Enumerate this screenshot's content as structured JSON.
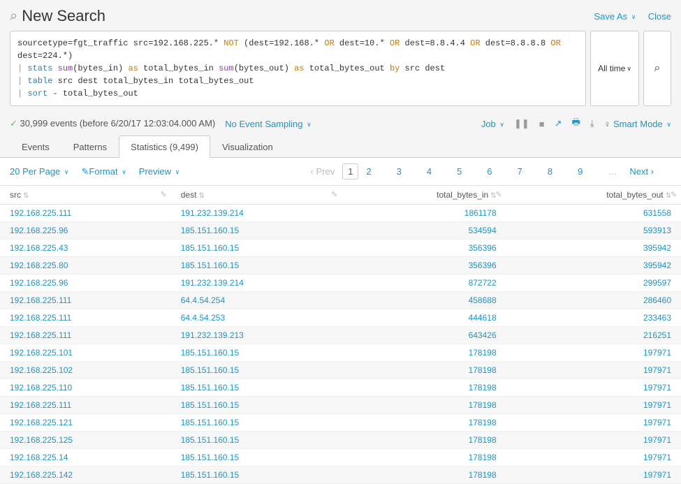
{
  "header": {
    "title": "New Search",
    "save_as": "Save As",
    "close": "Close"
  },
  "search": {
    "query_html": "sourcetype=fgt_traffic src=192.168.225.* <span class='kw-bool'>NOT</span> (dest=192.168.* <span class='kw-bool'>OR</span> dest=10.* <span class='kw-bool'>OR</span> dest=8.8.4.4 <span class='kw-bool'>OR</span> dest=8.8.8.8 <span class='kw-bool'>OR</span> dest=224.*)\n<span class='pipe'>|</span> <span class='kw-cmd'>stats</span> <span class='kw-func'>sum</span>(bytes_in) <span class='kw-as'>as</span> total_bytes_in <span class='kw-func'>sum</span>(bytes_out) <span class='kw-as'>as</span> total_bytes_out <span class='kw-as'>by</span> src dest\n<span class='pipe'>|</span> <span class='kw-cmd'>table</span> src dest total_bytes_in total_bytes_out\n<span class='pipe'>|</span> <span class='kw-cmd'>sort</span> - total_bytes_out",
    "timerange": "All time",
    "search_icon": "⌕"
  },
  "eventbar": {
    "events_label": "30,999 events (before 6/20/17 12:03:04.000 AM)",
    "sampling": "No Event Sampling",
    "job": "Job",
    "smart_mode": "Smart Mode"
  },
  "tabs": [
    {
      "label": "Events",
      "active": false
    },
    {
      "label": "Patterns",
      "active": false
    },
    {
      "label": "Statistics (9,499)",
      "active": true
    },
    {
      "label": "Visualization",
      "active": false
    }
  ],
  "toolbar": {
    "per_page": "20 Per Page",
    "format": "Format",
    "preview": "Preview",
    "prev": "Prev",
    "next": "Next",
    "pages": [
      "1",
      "2",
      "3",
      "4",
      "5",
      "6",
      "7",
      "8",
      "9"
    ],
    "current_page": 1
  },
  "columns": [
    {
      "key": "src",
      "label": "src",
      "align": "left",
      "pencil": true
    },
    {
      "key": "dest",
      "label": "dest",
      "align": "left",
      "pencil": true
    },
    {
      "key": "total_bytes_in",
      "label": "total_bytes_in",
      "align": "right",
      "pencil": true
    },
    {
      "key": "total_bytes_out",
      "label": "total_bytes_out",
      "align": "right",
      "pencil": true
    }
  ],
  "rows": [
    {
      "src": "192.168.225.111",
      "dest": "191.232.139.214",
      "total_bytes_in": "1861178",
      "total_bytes_out": "631558"
    },
    {
      "src": "192.168.225.96",
      "dest": "185.151.160.15",
      "total_bytes_in": "534594",
      "total_bytes_out": "593913"
    },
    {
      "src": "192.168.225.43",
      "dest": "185.151.160.15",
      "total_bytes_in": "356396",
      "total_bytes_out": "395942"
    },
    {
      "src": "192.168.225.80",
      "dest": "185.151.160.15",
      "total_bytes_in": "356396",
      "total_bytes_out": "395942"
    },
    {
      "src": "192.168.225.96",
      "dest": "191.232.139.214",
      "total_bytes_in": "872722",
      "total_bytes_out": "299597"
    },
    {
      "src": "192.168.225.111",
      "dest": "64.4.54.254",
      "total_bytes_in": "458688",
      "total_bytes_out": "286460"
    },
    {
      "src": "192.168.225.111",
      "dest": "64.4.54.253",
      "total_bytes_in": "444618",
      "total_bytes_out": "233463"
    },
    {
      "src": "192.168.225.111",
      "dest": "191.232.139.213",
      "total_bytes_in": "643426",
      "total_bytes_out": "216251"
    },
    {
      "src": "192.168.225.101",
      "dest": "185.151.160.15",
      "total_bytes_in": "178198",
      "total_bytes_out": "197971"
    },
    {
      "src": "192.168.225.102",
      "dest": "185.151.160.15",
      "total_bytes_in": "178198",
      "total_bytes_out": "197971"
    },
    {
      "src": "192.168.225.110",
      "dest": "185.151.160.15",
      "total_bytes_in": "178198",
      "total_bytes_out": "197971"
    },
    {
      "src": "192.168.225.111",
      "dest": "185.151.160.15",
      "total_bytes_in": "178198",
      "total_bytes_out": "197971"
    },
    {
      "src": "192.168.225.121",
      "dest": "185.151.160.15",
      "total_bytes_in": "178198",
      "total_bytes_out": "197971"
    },
    {
      "src": "192.168.225.125",
      "dest": "185.151.160.15",
      "total_bytes_in": "178198",
      "total_bytes_out": "197971"
    },
    {
      "src": "192.168.225.14",
      "dest": "185.151.160.15",
      "total_bytes_in": "178198",
      "total_bytes_out": "197971"
    },
    {
      "src": "192.168.225.142",
      "dest": "185.151.160.15",
      "total_bytes_in": "178198",
      "total_bytes_out": "197971"
    }
  ]
}
